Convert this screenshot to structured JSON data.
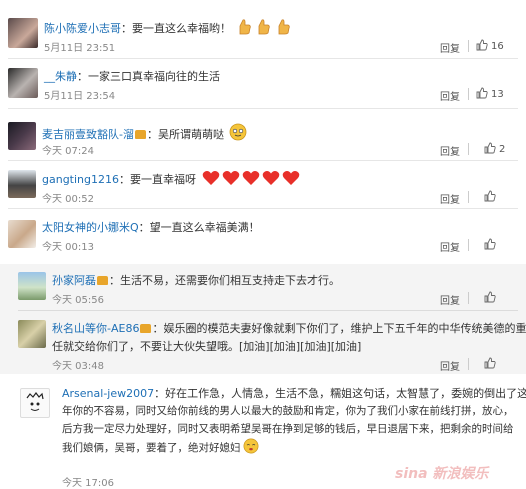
{
  "comments_top": [
    {
      "user": "陈小陈爱小志哥",
      "sep": "：",
      "text": "要一直这么幸福哟！",
      "emojis": [
        "thumbs-up-emoji",
        "thumbs-up-emoji",
        "thumbs-up-emoji"
      ],
      "time": "5月11日 23:51",
      "reply": "回复",
      "likes": "16"
    },
    {
      "user": "__朱静",
      "sep": "：",
      "text": "一家三口真幸福向往的生活",
      "time": "5月11日 23:54",
      "reply": "回复",
      "likes": "13"
    },
    {
      "user": "麦吉丽壹致豁队-溜",
      "sep": "：",
      "text": "吴所谓萌萌哒",
      "emojis": [
        "cute-face-emoji"
      ],
      "time": "今天 07:24",
      "reply": "回复",
      "likes": "2"
    },
    {
      "user": "gangting1216",
      "sep": "：",
      "text": "要一直幸福呀",
      "emojis": [
        "heart-emoji",
        "heart-emoji",
        "heart-emoji",
        "heart-emoji",
        "heart-emoji"
      ],
      "time": "今天 00:52",
      "reply": "回复",
      "likes": ""
    },
    {
      "user": "太阳女神的小娜米Q",
      "sep": "：",
      "text": "望一直这么幸福美满！",
      "time": "今天 00:13",
      "reply": "回复",
      "likes": ""
    }
  ],
  "comments_mid": [
    {
      "user": "孙家阿磊",
      "sep": "：",
      "text": "生活不易，还需要你们相互支持走下去才行。",
      "time": "今天 05:56",
      "reply": "回复",
      "likes": ""
    },
    {
      "user": "秋名山等你-AE86",
      "sep": "：",
      "text_line1": "娱乐圈的模范夫妻好像就剩下你们了，维护上下五千年的中华传统美德的重",
      "text_line2": "任就交给你们了，不要让大伙失望哦。[加油][加油][加油][加油]",
      "time": "今天 03:48",
      "reply": "回复",
      "likes": ""
    }
  ],
  "comments_bottom": [
    {
      "user": "Arsenal-jew2007",
      "sep": "：",
      "lines": [
        "好在工作急，人情急，生活不急，糯姐这句话，太智慧了，委婉的倒出了这几",
        "年你的不容易，同时又给你前线的男人以最大的鼓励和肯定，你为了我们小家在前线打拼，放心，",
        "后方我一定尽力处理好，同时又表明希望吴哥在挣到足够的钱后，早日退居下来，把剩余的时间给",
        "我们娘俩，吴哥，要着了，绝对好媳妇"
      ],
      "time": "今天 17:06",
      "reply": "回复",
      "likes": ""
    }
  ],
  "watermark": "sina 新浪娱乐",
  "colors": {
    "username": "#1e6fb5",
    "heart": "#e8302a",
    "emoji_face": "#f5c53a"
  }
}
